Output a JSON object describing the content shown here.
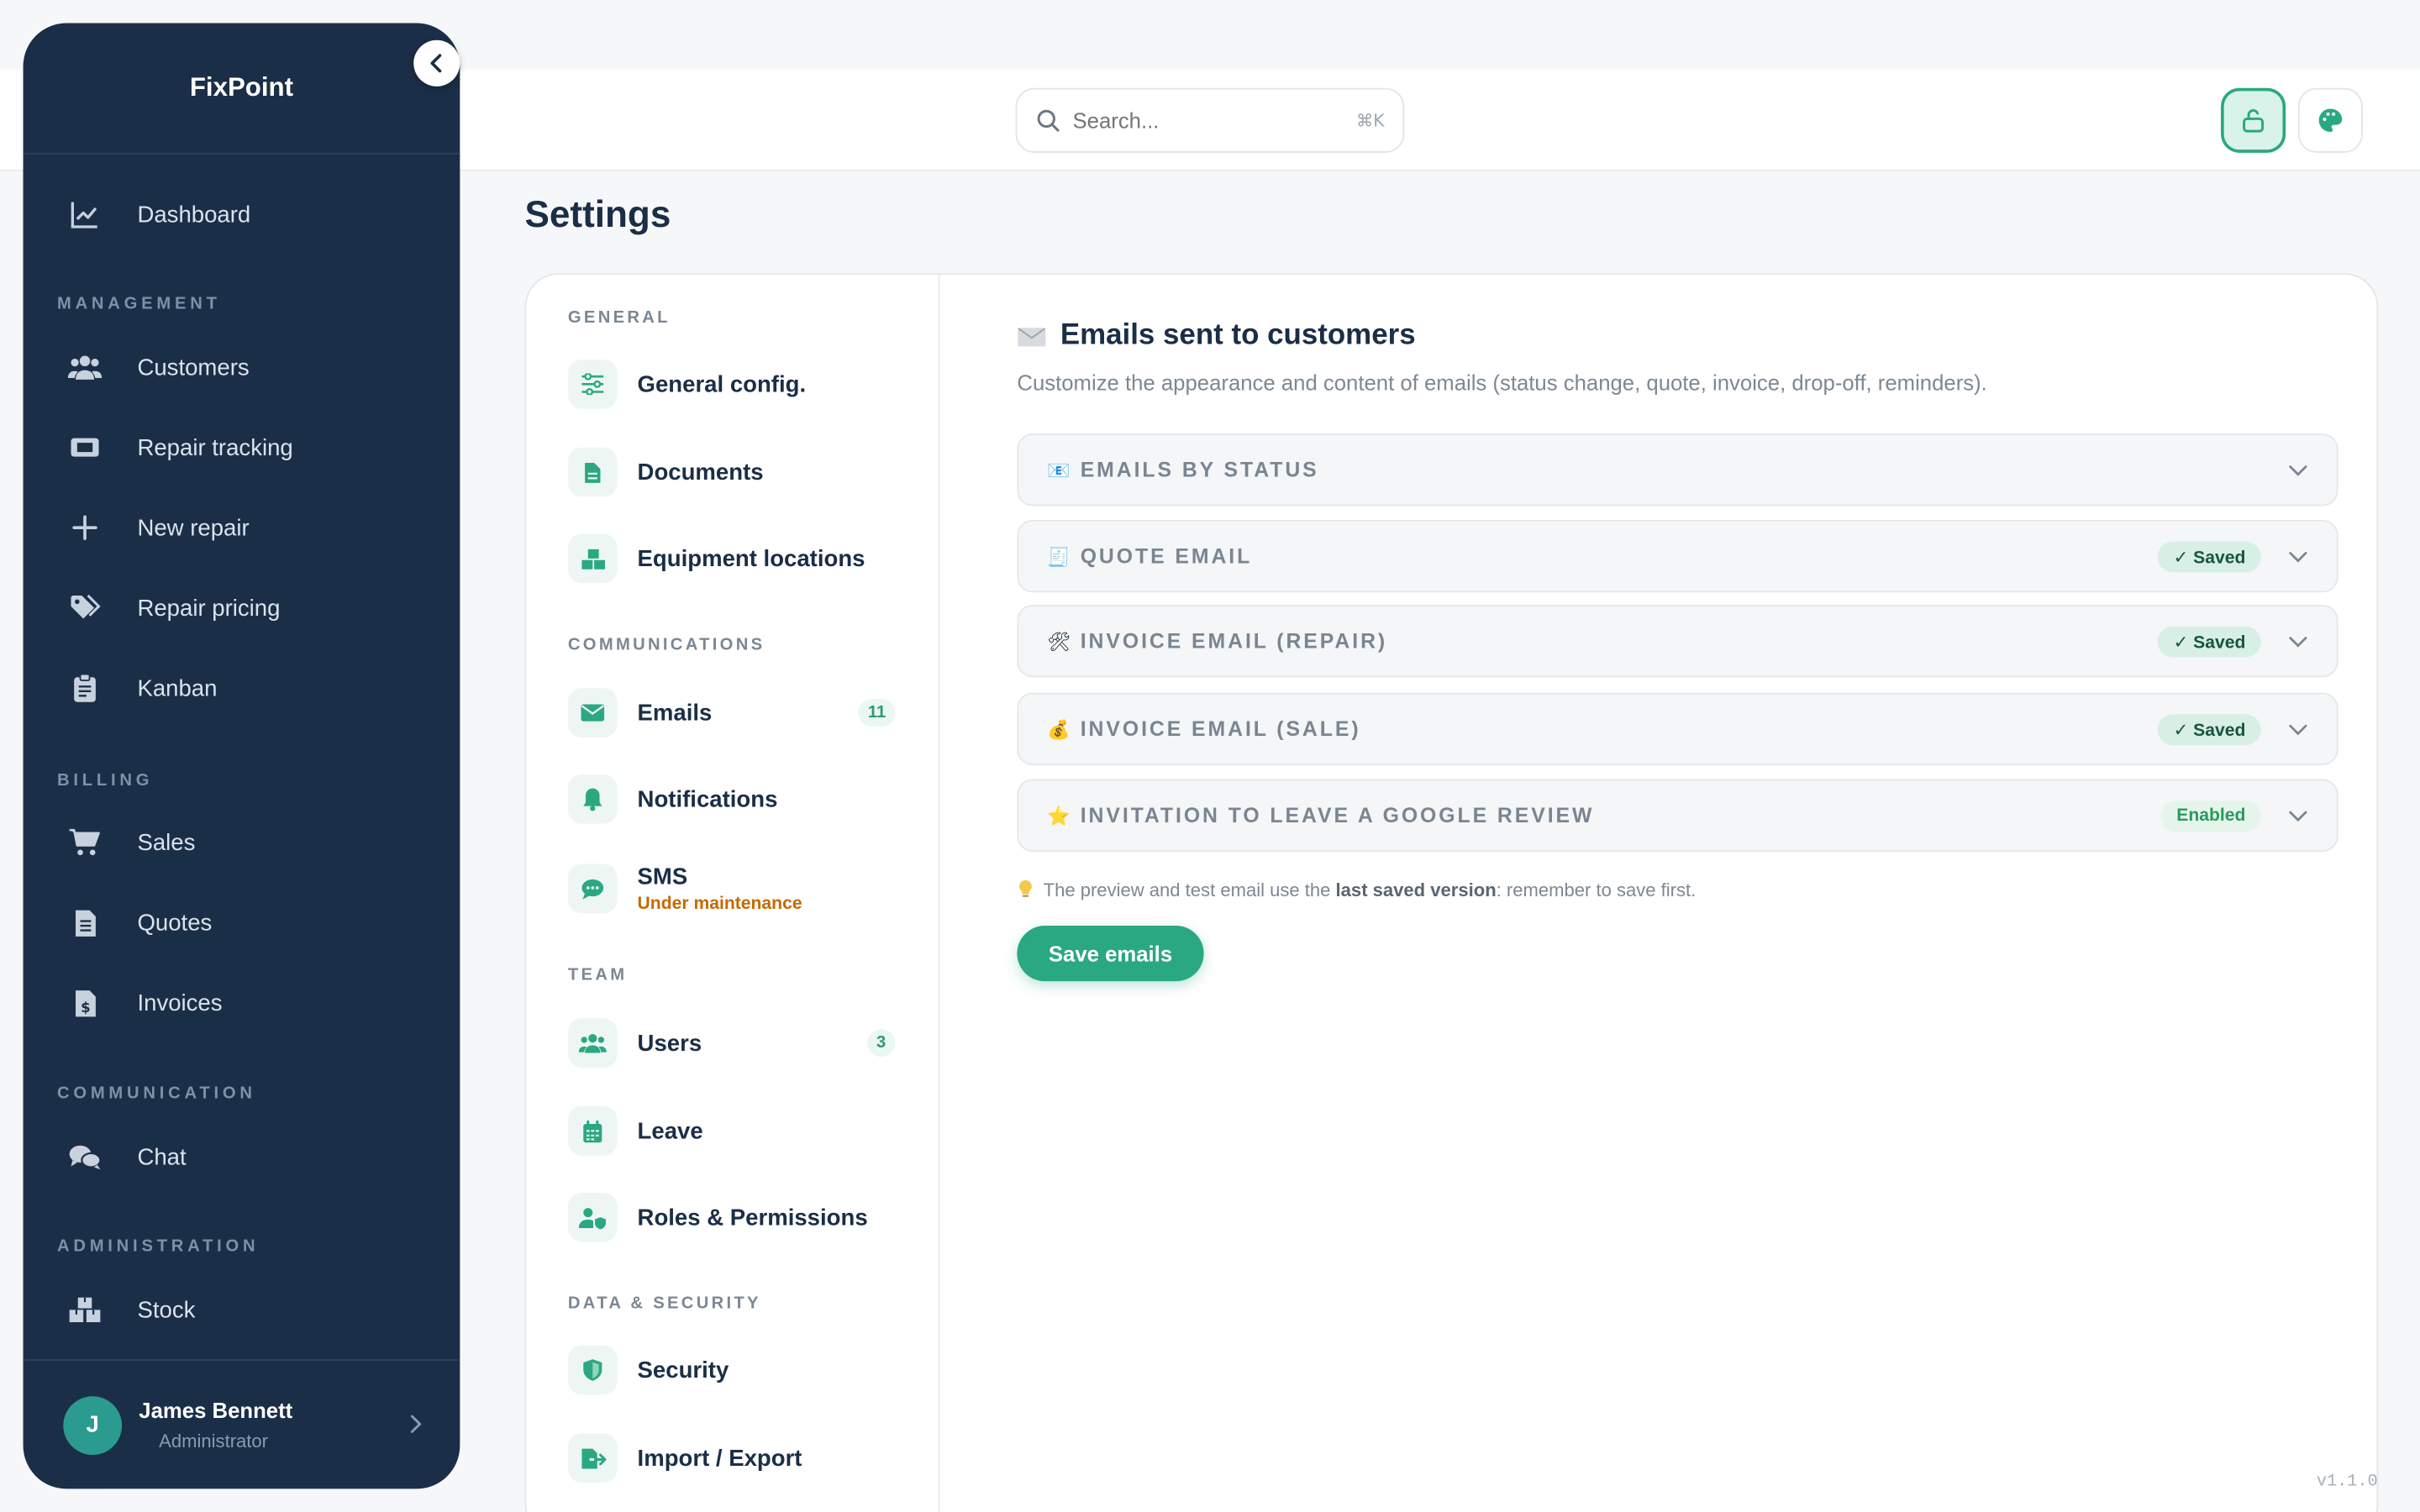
{
  "app": {
    "name": "FixPoint",
    "version": "v1.1.0"
  },
  "search": {
    "placeholder": "Search...",
    "shortcut": "⌘K"
  },
  "sidebar": {
    "items": {
      "dashboard": "Dashboard",
      "customers": "Customers",
      "repair_tracking": "Repair tracking",
      "new_repair": "New repair",
      "repair_pricing": "Repair pricing",
      "kanban": "Kanban",
      "sales": "Sales",
      "quotes": "Quotes",
      "invoices": "Invoices",
      "chat": "Chat",
      "stock": "Stock"
    },
    "sections": {
      "management": "MANAGEMENT",
      "billing": "BILLING",
      "communication": "COMMUNICATION",
      "administration": "ADMINISTRATION"
    },
    "user": {
      "initial": "J",
      "name": "James Bennett",
      "role": "Administrator"
    }
  },
  "page": {
    "title": "Settings"
  },
  "settings_nav": {
    "sections": {
      "general": "GENERAL",
      "communications": "COMMUNICATIONS",
      "team": "TEAM",
      "data_security": "DATA & SECURITY"
    },
    "items": {
      "general_config": "General config.",
      "documents": "Documents",
      "equipment_locations": "Equipment locations",
      "emails": "Emails",
      "emails_count": "11",
      "notifications": "Notifications",
      "sms": "SMS",
      "sms_status": "Under maintenance",
      "users": "Users",
      "users_count": "3",
      "leave": "Leave",
      "roles": "Roles & Permissions",
      "security": "Security",
      "import_export": "Import / Export"
    }
  },
  "content": {
    "title": "Emails sent to customers",
    "description": "Customize the appearance and content of emails (status change, quote, invoice, drop-off, reminders).",
    "accordions": [
      {
        "emoji": "📧",
        "title": "EMAILS BY STATUS",
        "badge": ""
      },
      {
        "emoji": "🧾",
        "title": "QUOTE EMAIL",
        "badge": "✓ Saved"
      },
      {
        "emoji": "🛠",
        "title": "INVOICE EMAIL (REPAIR)",
        "badge": "✓ Saved"
      },
      {
        "emoji": "💰",
        "title": "INVOICE EMAIL (SALE)",
        "badge": "✓ Saved"
      },
      {
        "emoji": "⭐",
        "title": "INVITATION TO LEAVE A GOOGLE REVIEW",
        "badge": "Enabled"
      }
    ],
    "hint_before": "The preview and test email use the ",
    "hint_bold": "last saved version",
    "hint_after": ": remember to save first.",
    "save_label": "Save emails"
  },
  "colors": {
    "sidebar_bg": "#1b2e47",
    "accent": "#2aa882",
    "warning": "#c56a00"
  }
}
